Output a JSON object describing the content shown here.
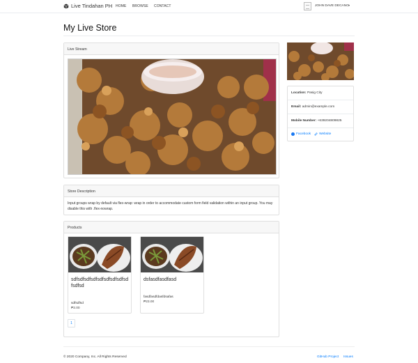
{
  "navbar": {
    "brand": "Live Tindahan PH",
    "links": [
      "HOME",
      "BROWSE",
      "CONTACT"
    ],
    "user": "JOHN DAVE DECANO"
  },
  "page_title": "My Live Store",
  "stream": {
    "header": "Live Stream"
  },
  "description": {
    "header": "Store Description",
    "text": "Input groups wrap by default via flex-wrap: wrap in order to accommodate custom form field validation within an input group. You may disable this with .flex-nowrap."
  },
  "products": {
    "header": "Products",
    "items": [
      {
        "name": "sdfsdfsdfsdfsdfsdfsdfsdfsdfsdfsd",
        "price": "₱2.00",
        "desc": "sdfsdfsd"
      },
      {
        "name": "dsfasdfasdfasd",
        "price": "₱23.00",
        "desc": "fasdfasdfdasfdsafas"
      }
    ],
    "pagination": [
      "1"
    ]
  },
  "sidebar": {
    "location_label": "Location:",
    "location": "Pasig City",
    "email_label": "Email:",
    "email": "admin@example.com",
    "mobile_label": "Mobile Number:",
    "mobile": "+639204809825",
    "facebook": "Facebook",
    "website": "Website"
  },
  "footer": {
    "copyright": "© 2020 Company, Inc. All Rights Reserved",
    "github": "GitHub Project",
    "issues": "Issues"
  },
  "colors": {
    "link": "#007bff",
    "facebook": "#1877f2"
  }
}
